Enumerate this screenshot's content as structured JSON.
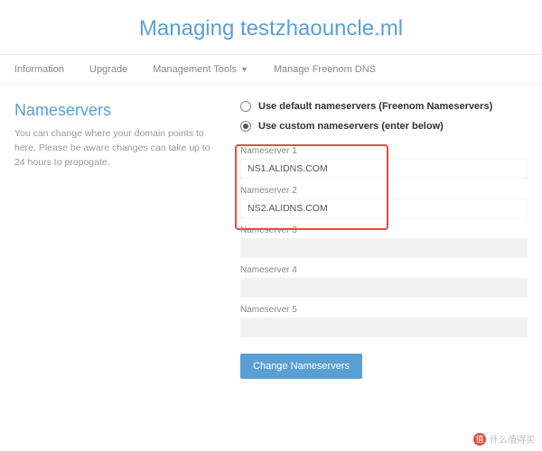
{
  "title": "Managing testzhaouncle.ml",
  "tabs": {
    "information": "Information",
    "upgrade": "Upgrade",
    "management_tools": "Management Tools",
    "manage_dns": "Manage Freenom DNS"
  },
  "section": {
    "title": "Nameservers",
    "help": "You can change where your domain points to here. Please be aware changes can take up to 24 hours to propogate."
  },
  "options": {
    "default_label": "Use default nameservers (Freenom Nameservers)",
    "custom_label": "Use custom nameservers (enter below)"
  },
  "nameservers": [
    {
      "label": "Nameserver 1",
      "value": "NS1.ALIDNS.COM"
    },
    {
      "label": "Nameserver 2",
      "value": "NS2.ALIDNS.COM"
    },
    {
      "label": "Nameserver 3",
      "value": ""
    },
    {
      "label": "Nameserver 4",
      "value": ""
    },
    {
      "label": "Nameserver 5",
      "value": ""
    }
  ],
  "button": {
    "change": "Change Nameservers"
  },
  "watermark": {
    "badge": "值",
    "text": "什么值得买"
  }
}
